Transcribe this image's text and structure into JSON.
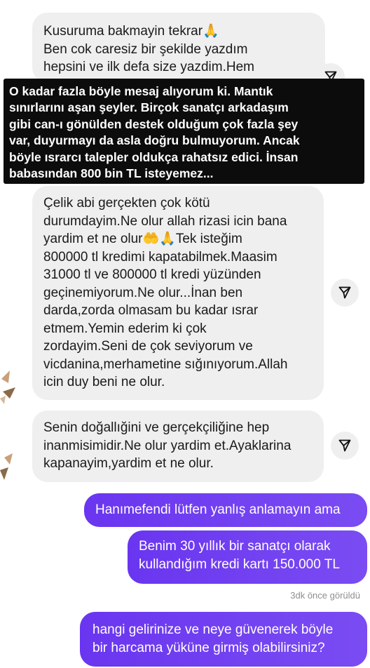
{
  "messages_incoming": [
    {
      "lines": [
        "Kusuruma bakmayin tekrar🙏",
        "Ben cok caresiz bir şekilde yazdım",
        "hepsini ve ilk defa size yazdim.Hem"
      ]
    },
    {
      "lines": [
        "Çelik abi gerçekten çok kötü",
        "durumdayim.Ne olur allah rizasi icin bana",
        "yardim et ne olur🤲🙏Tek isteğim",
        "800000 tl kredimi kapatabilmek.Maasim",
        "31000 tl ve 800000 tl kredi yüzünden",
        "geçinemiyorum.Ne olur...İnan ben",
        "darda,zorda olmasam bu kadar ısrar",
        "etmem.Yemin ederim ki çok",
        "zordayim.Seni de çok seviyorum ve",
        "vicdanina,merhametine sığınıyorum.Allah",
        "icin duy beni ne olur."
      ]
    },
    {
      "lines": [
        "Senin doğallığini ve gerçekçiliğine hep",
        "inanmisimidir.Ne olur yardim et.Ayaklarina",
        "kapanayim,yardim et ne olur."
      ]
    }
  ],
  "overlay_caption": {
    "lines": [
      "O kadar fazla böyle mesaj alıyorum ki.   Mantık",
      "sınırlarını aşan şeyler. Birçok sanatçı arkadaşım",
      "gibi can-ı gönülden destek olduğum çok fazla şey",
      "var, duyurmayı da asla doğru bulmuyorum. Ancak",
      "böyle ısrarcı talepler oldukça rahatsız edici. İnsan",
      "babasından 800 bin TL isteyemez..."
    ]
  },
  "messages_outgoing": [
    {
      "lines": [
        "Hanımefendi lütfen yanlış anlamayın ama"
      ]
    },
    {
      "lines": [
        "Benim 30 yıllık bir sanatçı olarak",
        "kullandığım kredi kartı 150.000 TL"
      ]
    },
    {
      "lines": [
        "hangi gelirinize ve neye güvenerek böyle",
        "bir harcama yüküne girmiş olabilirsiniz?"
      ]
    }
  ],
  "seen_status": "3dk önce görüldü",
  "icons": {
    "share": "paper-plane-icon"
  },
  "colors": {
    "incoming_bg": "#efefef",
    "outgoing_bg": "#7040f0",
    "overlay_bg": "#0c0c0c",
    "seen_text": "#8e8e8e"
  }
}
